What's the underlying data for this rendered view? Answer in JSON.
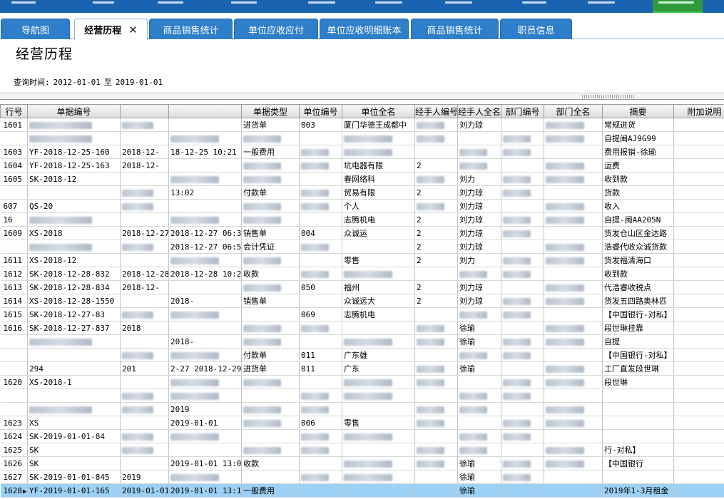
{
  "tabs": [
    {
      "label": "导航图",
      "active": false
    },
    {
      "label": "经营历程",
      "active": true
    },
    {
      "label": "商品销售统计",
      "active": false
    },
    {
      "label": "单位应收应付",
      "active": false
    },
    {
      "label": "单位应收明细账本",
      "active": false
    },
    {
      "label": "商品销售统计",
      "active": false
    },
    {
      "label": "职员信息",
      "active": false
    }
  ],
  "page": {
    "title": "经营历程",
    "query_label": "查询时间:",
    "date_from": "2012-01-01",
    "date_sep": "至",
    "date_to": "2019-01-01"
  },
  "table": {
    "columns": [
      "行号",
      "单据编号",
      "",
      "",
      "单据类型",
      "单位编号",
      "单位全名",
      "经手人编号",
      "经手人全名",
      "部门编号",
      "部门全名",
      "摘要",
      "附加说明"
    ],
    "rows": [
      {
        "rn": "1601",
        "docno": "",
        "d1": "",
        "d2": "",
        "type": "进货单",
        "uid": "003",
        "uname": "厦门华德王成都中",
        "eid": "",
        "ename": "刘力琼",
        "dept_id": "",
        "dept": "",
        "memo": "常规进货",
        "note": ""
      },
      {
        "rn": "",
        "docno": "",
        "d1": "",
        "d2": "",
        "type": "",
        "uid": "",
        "uname": "",
        "eid": "",
        "ename": "",
        "dept_id": "",
        "dept": "",
        "memo": "自提闽AJ9G99",
        "note": ""
      },
      {
        "rn": "1603",
        "docno": "YF-2018-12-25-160",
        "d1": "2018-12-",
        "d2": "18-12-25 10:21",
        "type": "一般费用",
        "uid": "",
        "uname": "",
        "eid": "",
        "ename": "",
        "dept_id": "",
        "dept": "",
        "memo": "费用报销-徐瑜",
        "note": ""
      },
      {
        "rn": "1604",
        "docno": "YF-2018-12-25-163",
        "d1": "2018-12-",
        "d2": "",
        "type": "",
        "uid": "",
        "uname": "坑电器有限",
        "eid": "2",
        "ename": "",
        "dept_id": "",
        "dept": "",
        "memo": "运费",
        "note": ""
      },
      {
        "rn": "1605",
        "docno": "SK-2018-12",
        "d1": "",
        "d2": "",
        "type": "",
        "uid": "",
        "uname": "春网络科",
        "eid": "",
        "ename": "刘力",
        "dept_id": "",
        "dept": "",
        "memo": "收到款",
        "note": ""
      },
      {
        "rn": "",
        "docno": "",
        "d1": "",
        "d2": "13:02",
        "type": "付款单",
        "uid": "",
        "uname": "贸易有限",
        "eid": "2",
        "ename": "刘力琼",
        "dept_id": "",
        "dept": "",
        "memo": "货款",
        "note": ""
      },
      {
        "rn": "607",
        "docno": "QS-20",
        "d1": "",
        "d2": "",
        "type": "",
        "uid": "",
        "uname": "个人",
        "eid": "",
        "ename": "刘力琼",
        "dept_id": "",
        "dept": "",
        "memo": "收入",
        "note": ""
      },
      {
        "rn": "16",
        "docno": "",
        "d1": "",
        "d2": "",
        "type": "",
        "uid": "",
        "uname": "志腾机电",
        "eid": "2",
        "ename": "刘力琼",
        "dept_id": "",
        "dept": "",
        "memo": "自提-闽AA205N",
        "note": ""
      },
      {
        "rn": "1609",
        "docno": "XS-2018",
        "d1": "2018-12-27",
        "d2": "2018-12-27 06:33",
        "type": "销售单",
        "uid": "004",
        "uname": "众诚运",
        "eid": "2",
        "ename": "刘力琼",
        "dept_id": "",
        "dept": "",
        "memo": "货发仓山区金达路",
        "note": ""
      },
      {
        "rn": "",
        "docno": "",
        "d1": "",
        "d2": "2018-12-27 06:55",
        "type": "会计凭证",
        "uid": "",
        "uname": "",
        "eid": "2",
        "ename": "刘力琼",
        "dept_id": "",
        "dept": "",
        "memo": "浩睿代收众诚货款",
        "note": ""
      },
      {
        "rn": "1611",
        "docno": "XS-2018-12",
        "d1": "",
        "d2": "",
        "type": "",
        "uid": "",
        "uname": "零售",
        "eid": "2",
        "ename": "刘力",
        "dept_id": "",
        "dept": "",
        "memo": "货发福清海口",
        "note": ""
      },
      {
        "rn": "1612",
        "docno": "SK-2018-12-28-832",
        "d1": "2018-12-28",
        "d2": "2018-12-28 10:26",
        "type": "收款",
        "uid": "",
        "uname": "",
        "eid": "",
        "ename": "",
        "dept_id": "",
        "dept": "",
        "memo": "收到款",
        "note": ""
      },
      {
        "rn": "1613",
        "docno": "SK-2018-12-28-834",
        "d1": "2018-12-",
        "d2": "",
        "type": "",
        "uid": "050",
        "uname": "福州",
        "eid": "2",
        "ename": "刘力琼",
        "dept_id": "",
        "dept": "",
        "memo": "代浩睿收税点",
        "note": ""
      },
      {
        "rn": "1614",
        "docno": "XS-2018-12-28-1550",
        "d1": "",
        "d2": "2018-",
        "type": "销售单",
        "uid": "",
        "uname": "众诚远大",
        "eid": "2",
        "ename": "刘力琼",
        "dept_id": "",
        "dept": "",
        "memo": "货发五四路奥林匹",
        "note": ""
      },
      {
        "rn": "1615",
        "docno": "SK-2018-12-27-83",
        "d1": "",
        "d2": "",
        "type": "",
        "uid": "069",
        "uname": "志腾机电",
        "eid": "",
        "ename": "",
        "dept_id": "",
        "dept": "",
        "memo": "【中国银行-对私】",
        "note": ""
      },
      {
        "rn": "1616",
        "docno": "SK-2018-12-27-837",
        "d1": "2018",
        "d2": "",
        "type": "",
        "uid": "",
        "uname": "",
        "eid": "",
        "ename": "徐瑜",
        "dept_id": "",
        "dept": "",
        "memo": "段世琳挂靠",
        "note": ""
      },
      {
        "rn": "",
        "docno": "",
        "d1": "",
        "d2": "2018-",
        "type": "",
        "uid": "",
        "uname": "",
        "eid": "",
        "ename": "徐瑜",
        "dept_id": "",
        "dept": "",
        "memo": "自提",
        "note": ""
      },
      {
        "rn": "",
        "docno": "",
        "d1": "",
        "d2": "",
        "type": "付款单",
        "uid": "011",
        "uname": "广东雄",
        "eid": "",
        "ename": "",
        "dept_id": "",
        "dept": "",
        "memo": "【中国银行-对私】",
        "note": ""
      },
      {
        "rn": "",
        "docno": "294",
        "d1": "201",
        "d2": "2-27 2018-12-29 10:02",
        "type": "进货单",
        "uid": "011",
        "uname": "广东",
        "eid": "",
        "ename": "徐瑜",
        "dept_id": "",
        "dept": "",
        "memo": "工厂直发段世琳",
        "note": ""
      },
      {
        "rn": "1620",
        "docno": "XS-2018-1",
        "d1": "",
        "d2": "",
        "type": "",
        "uid": "",
        "uname": "",
        "eid": "",
        "ename": "",
        "dept_id": "",
        "dept": "",
        "memo": "段世琳",
        "note": ""
      },
      {
        "rn": "",
        "docno": "",
        "d1": "",
        "d2": "",
        "type": "",
        "uid": "",
        "uname": "",
        "eid": "",
        "ename": "",
        "dept_id": "",
        "dept": "",
        "memo": "",
        "note": ""
      },
      {
        "rn": "",
        "docno": "",
        "d1": "",
        "d2": "2019",
        "type": "",
        "uid": "",
        "uname": "",
        "eid": "",
        "ename": "",
        "dept_id": "",
        "dept": "",
        "memo": "",
        "note": ""
      },
      {
        "rn": "1623",
        "docno": "XS",
        "d1": "",
        "d2": "2019-01-01",
        "type": "",
        "uid": "006",
        "uname": "零售",
        "eid": "",
        "ename": "",
        "dept_id": "",
        "dept": "",
        "memo": "",
        "note": ""
      },
      {
        "rn": "1624",
        "docno": "SK-2019-01-01-84",
        "d1": "",
        "d2": "",
        "type": "",
        "uid": "",
        "uname": "",
        "eid": "",
        "ename": "",
        "dept_id": "",
        "dept": "",
        "memo": "",
        "note": ""
      },
      {
        "rn": "1625",
        "docno": "SK",
        "d1": "",
        "d2": "",
        "type": "",
        "uid": "",
        "uname": "",
        "eid": "",
        "ename": "",
        "dept_id": "",
        "dept": "",
        "memo": "行-对私】",
        "note": ""
      },
      {
        "rn": "1626",
        "docno": "SK",
        "d1": "",
        "d2": "2019-01-01 13:09",
        "type": "收款",
        "uid": "",
        "uname": "",
        "eid": "",
        "ename": "徐瑜",
        "dept_id": "",
        "dept": "",
        "memo": "【中国银行",
        "note": ""
      },
      {
        "rn": "1627",
        "docno": "SK-2019-01-01-845",
        "d1": "2019",
        "d2": "",
        "type": "",
        "uid": "",
        "uname": "",
        "eid": "",
        "ename": "徐瑜",
        "dept_id": "",
        "dept": "",
        "memo": "",
        "note": ""
      },
      {
        "rn": "1628",
        "docno": "YF-2019-01-01-165",
        "d1": "2019-01-01",
        "d2": "2019-01-01 13:12",
        "type": "一般费用",
        "uid": "",
        "uname": "",
        "eid": "",
        "ename": "徐瑜",
        "dept_id": "",
        "dept": "",
        "memo": "2019年1-3月租金",
        "note": "",
        "selected": true
      }
    ]
  },
  "colors": {
    "nav": "#1a63b0",
    "tab": "#2f7ec9",
    "selected_row": "#9cd0f5",
    "active_nav": "#2f9a3b"
  },
  "icons": {
    "close": "close-icon",
    "row_pointer": "row-pointer-icon"
  }
}
